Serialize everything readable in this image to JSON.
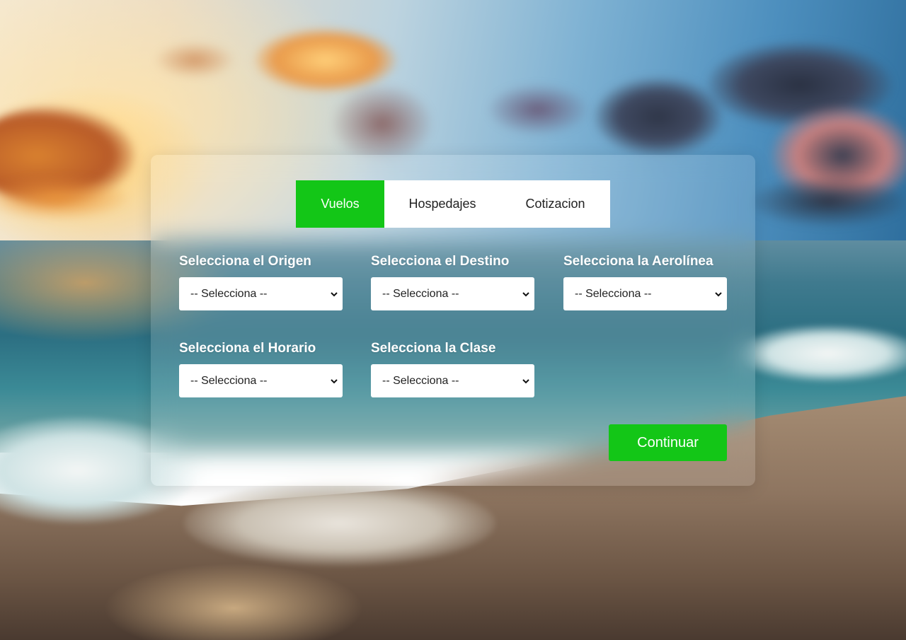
{
  "tabs": [
    {
      "label": "Vuelos",
      "active": true
    },
    {
      "label": "Hospedajes",
      "active": false
    },
    {
      "label": "Cotizacion",
      "active": false
    }
  ],
  "fields": {
    "origen": {
      "label": "Selecciona el Origen",
      "value": "-- Selecciona --"
    },
    "destino": {
      "label": "Selecciona el Destino",
      "value": "-- Selecciona --"
    },
    "aerolinea": {
      "label": "Selecciona la Aerolínea",
      "value": "-- Selecciona --"
    },
    "horario": {
      "label": "Selecciona el Horario",
      "value": "-- Selecciona --"
    },
    "clase": {
      "label": "Selecciona la Clase",
      "value": "-- Selecciona --"
    }
  },
  "actions": {
    "continue_label": "Continuar"
  },
  "colors": {
    "accent": "#13c617",
    "panel": "rgba(255,255,255,0.14)"
  },
  "icons": {
    "select_arrow": "chevron-down-icon"
  }
}
